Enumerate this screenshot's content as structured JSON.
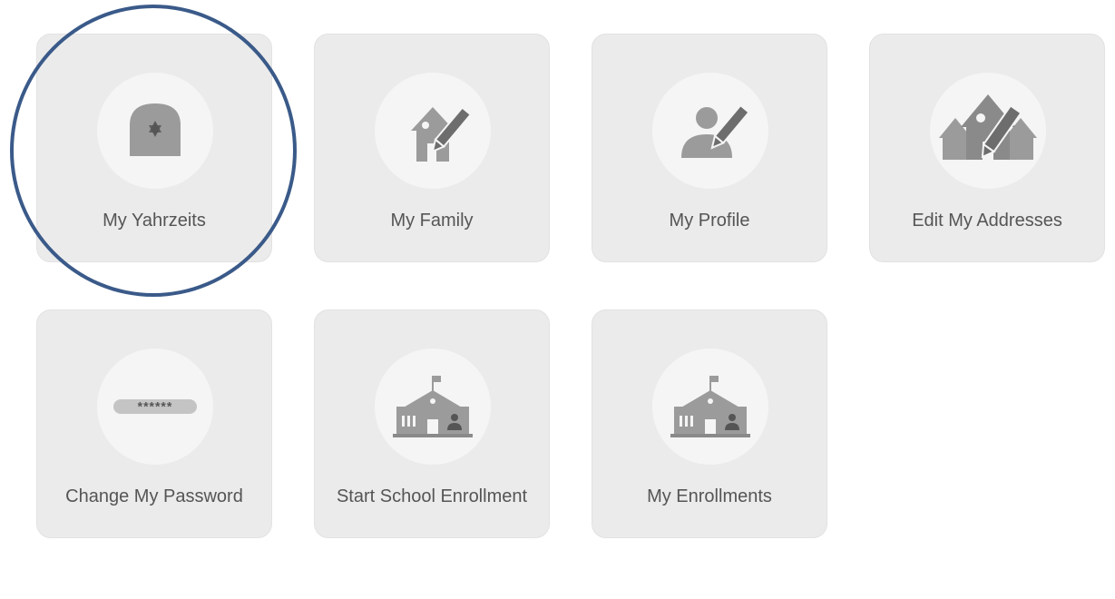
{
  "tiles": [
    {
      "label": "My Yahrzeits",
      "icon": "tombstone-star-icon"
    },
    {
      "label": "My Family",
      "icon": "house-pencil-icon"
    },
    {
      "label": "My Profile",
      "icon": "person-pencil-icon"
    },
    {
      "label": "Edit My Addresses",
      "icon": "houses-pencil-icon"
    },
    {
      "label": "Change My Password",
      "icon": "password-field-icon"
    },
    {
      "label": "Start School Enrollment",
      "icon": "school-building-icon"
    },
    {
      "label": "My Enrollments",
      "icon": "school-building-icon"
    }
  ],
  "password_mask": "******",
  "highlight": {
    "target": "My Yahrzeits",
    "color": "#3a5a89"
  },
  "colors": {
    "tile_bg": "#ebebeb",
    "icon_bg": "#f5f5f5",
    "icon": "#9b9b9b",
    "label": "#555555"
  }
}
